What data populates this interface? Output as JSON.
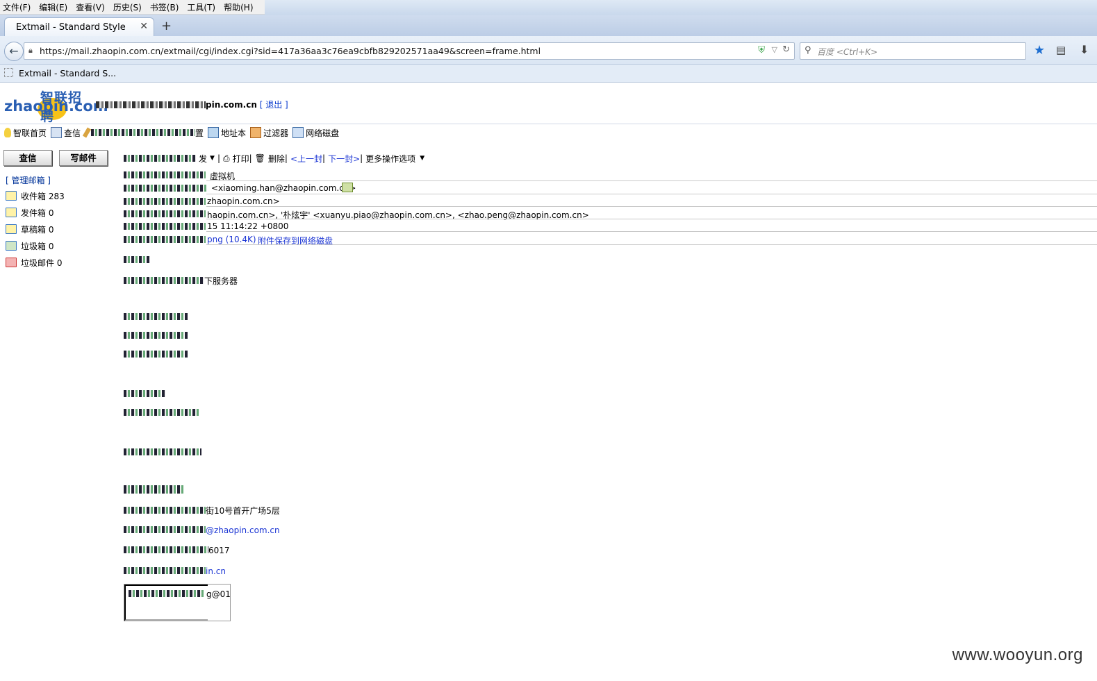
{
  "browser": {
    "menu": [
      "文件(F)",
      "编辑(E)",
      "查看(V)",
      "历史(S)",
      "书签(B)",
      "工具(T)",
      "帮助(H)"
    ],
    "tab_title": "Extmail - Standard Style",
    "url": "https://mail.zhaopin.com.cn/extmail/cgi/index.cgi?sid=417a36aa3c76ea9cbfb829202571aa49&screen=frame.html",
    "search_placeholder": "百度 <Ctrl+K>",
    "bookmark": "Extmail - Standard S..."
  },
  "header": {
    "logo_cn": "智联招聘",
    "logo_en": "zhaopin.com",
    "account_suffix": "pin.com.cn",
    "logout": "[ 退出 ]"
  },
  "toolbar": {
    "home": "智联首页",
    "check": "查信",
    "settings_tail": "置",
    "addressbook": "地址本",
    "filter": "过滤器",
    "netdisk": "网络磁盘"
  },
  "left": {
    "check_button": "查信",
    "compose_button": "写邮件",
    "manage": "[ 管理邮箱 ]",
    "folders": [
      {
        "name": "收件箱 283"
      },
      {
        "name": "发件箱 0"
      },
      {
        "name": "草稿箱 0"
      },
      {
        "name": "垃圾箱 0"
      },
      {
        "name": "垃圾邮件 0"
      }
    ]
  },
  "mail_toolbar": {
    "forward_tail": "发",
    "print": "打印",
    "delete": "删除",
    "prev": "<上一封",
    "next": "下一封>",
    "more": "更多操作选项"
  },
  "mail_header": {
    "subject_tail": "虚拟机",
    "from_tail": "<xiaoming.han@zhaopin.com.cn>",
    "to_tail": "zhaopin.com.cn>",
    "cc_tail": "haopin.com.cn>, '朴炫宇' <xuanyu.piao@zhaopin.com.cn>, <zhao.peng@zhaopin.com.cn>",
    "date_tail": "15 11:14:22 +0800",
    "attach_tail": "png (10.4K)",
    "attach_save": "附件保存到网络磁盘"
  },
  "mail_body": {
    "line_servers": "下服务器",
    "addr_tail": "街10号首开广场5层",
    "email_tail": "@zhaopin.com.cn",
    "phone_tail": "6017",
    "web_tail": "in.cn",
    "sig_tail": "g@01"
  },
  "watermark": "www.wooyun.org",
  "colors": {
    "link": "#1a34d4",
    "logo_blue": "#2a5fb3",
    "logo_yellow": "#f7c218"
  }
}
